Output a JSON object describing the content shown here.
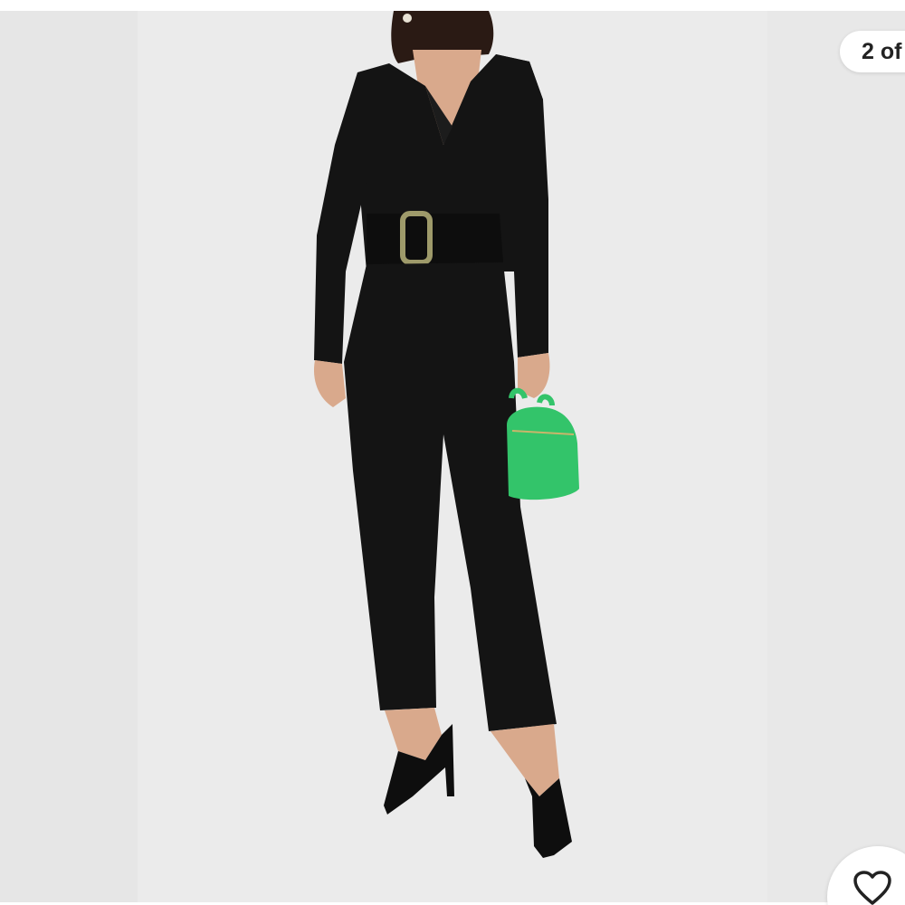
{
  "viewer": {
    "counter_text": "2 of",
    "like_icon": "heart-outline-icon"
  },
  "photo": {
    "background_color": "#ebebeb",
    "garment_color": "#141414",
    "bag_color": "#33c46a",
    "buckle_color": "#9e9a6a"
  }
}
